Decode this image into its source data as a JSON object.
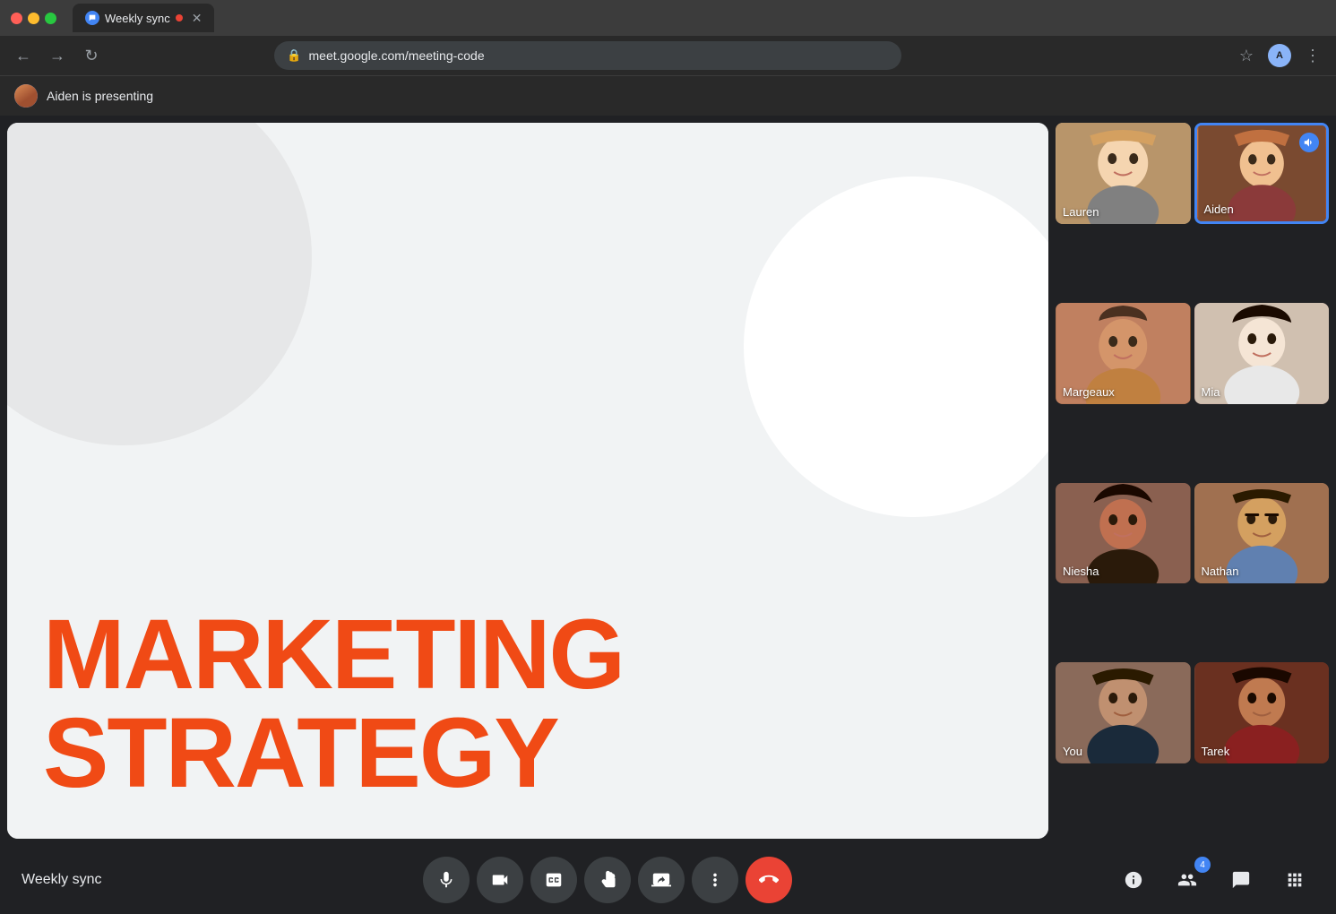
{
  "browser": {
    "tab_title": "Weekly sync",
    "url": "meet.google.com/meeting-code",
    "tab_dot_color": "#ea4335"
  },
  "presenter_bar": {
    "text": "Aiden is presenting"
  },
  "slide": {
    "headline_line1": "MARKETING",
    "headline_line2": "STRATEGY"
  },
  "participants": [
    {
      "id": "lauren",
      "name": "Lauren",
      "active": false
    },
    {
      "id": "aiden",
      "name": "Aiden",
      "active": true,
      "speaking": true
    },
    {
      "id": "margeaux",
      "name": "Margeaux",
      "active": false
    },
    {
      "id": "mia",
      "name": "Mia",
      "active": false
    },
    {
      "id": "niesha",
      "name": "Niesha",
      "active": false
    },
    {
      "id": "nathan",
      "name": "Nathan",
      "active": false
    },
    {
      "id": "you",
      "name": "You",
      "active": false
    },
    {
      "id": "tarek",
      "name": "Tarek",
      "active": false
    }
  ],
  "toolbar": {
    "meeting_title": "Weekly sync",
    "people_count": "4"
  },
  "icons": {
    "mic": "🎤",
    "camera": "📹",
    "captions": "CC",
    "hand": "✋",
    "present": "⬆",
    "more": "⋮",
    "end_call": "📞",
    "info": "ℹ",
    "people": "👥",
    "chat": "💬",
    "activities": "⚙"
  }
}
